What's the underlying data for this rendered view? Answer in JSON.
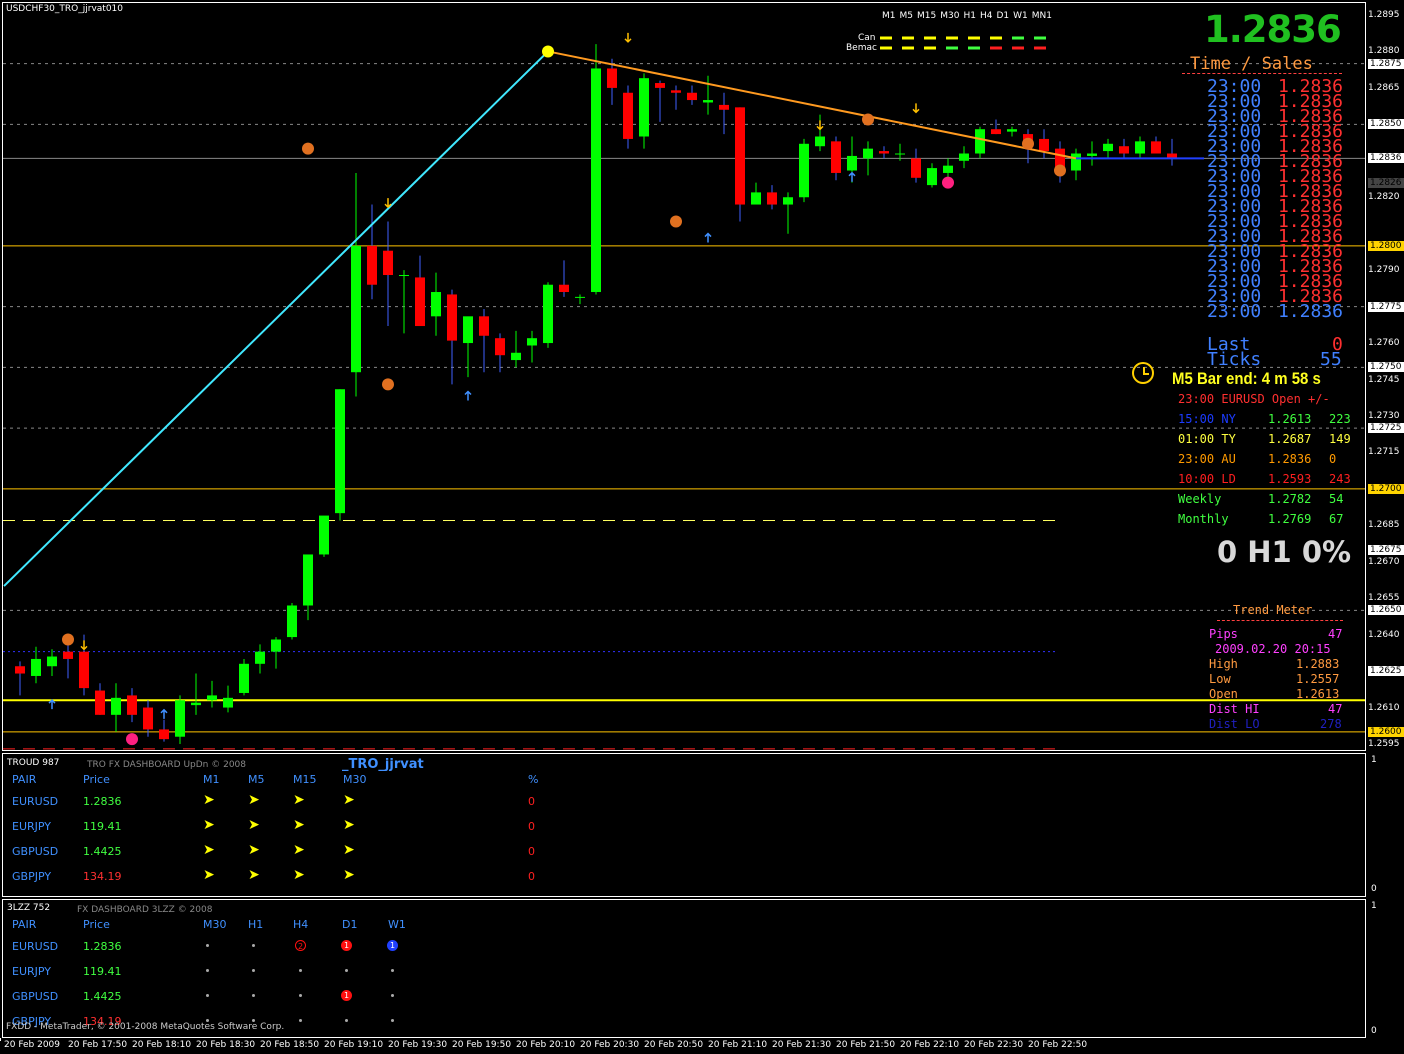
{
  "window": {
    "title": "USDCHF30_TRO_jjrvat010",
    "status_bar": "FXDD - MetaTrader, © 2001-2008 MetaQuotes Software Corp."
  },
  "timeframes": [
    "M1",
    "M5",
    "M15",
    "M30",
    "H1",
    "H4",
    "D1",
    "W1",
    "MN1"
  ],
  "legend": {
    "row1": "Can",
    "row2": "Bemac"
  },
  "big_price": "1.2836",
  "time_sales": {
    "title": "Time / Sales",
    "rows": [
      "23:00",
      "23:00",
      "23:00",
      "23:00",
      "23:00",
      "23:00",
      "23:00",
      "23:00",
      "23:00",
      "23:00",
      "23:00",
      "23:00",
      "23:00",
      "23:00",
      "23:00",
      "23:00"
    ],
    "price": "1.2836",
    "last_label": "Last",
    "last_value": "0",
    "ticks_label": "Ticks",
    "ticks_value": "55"
  },
  "bar_end": "M5 Bar end: 4 m 58 s",
  "sessions": {
    "header": "23:00 EURUSD Open +/-",
    "rows": [
      {
        "time": "15:00",
        "name": "NY",
        "price": "1.2613",
        "pips": "223",
        "color": "#1c3cff"
      },
      {
        "time": "01:00",
        "name": "TY",
        "price": "1.2687",
        "pips": "149",
        "color": "#ffff40"
      },
      {
        "time": "23:00",
        "name": "AU",
        "price": "1.2836",
        "pips": "0",
        "color": "#ff9a00"
      },
      {
        "time": "10:00",
        "name": "LD",
        "price": "1.2593",
        "pips": "243",
        "color": "#ff2020"
      }
    ],
    "weekly": {
      "label": "Weekly",
      "price": "1.2782",
      "pips": "54"
    },
    "monthly": {
      "label": "Monthly",
      "price": "1.2769",
      "pips": "67"
    }
  },
  "h1_pct": "0 H1 0%",
  "trend_meter": {
    "title": "Trend Meter",
    "pips_label": "Pips",
    "pips_value": "47",
    "date": "2009.02.20 20:15",
    "high_label": "High",
    "high_value": "1.2883",
    "low_label": "Low",
    "low_value": "1.2557",
    "open_label": "Open",
    "open_value": "1.2613",
    "dist_hi_label": "Dist HI",
    "dist_hi_value": "47",
    "dist_lo_label": "Dist LO",
    "dist_lo_value": "278"
  },
  "price_labels": [
    "1.2895",
    "1.2880",
    "1.2875",
    "1.2865",
    "1.2850",
    "1.2836",
    "1.2826",
    "1.2820",
    "1.2800",
    "1.2790",
    "1.2775",
    "1.2760",
    "1.2750",
    "1.2745",
    "1.2730",
    "1.2725",
    "1.2715",
    "1.2700",
    "1.2685",
    "1.2675",
    "1.2670",
    "1.2655",
    "1.2650",
    "1.2640",
    "1.2625",
    "1.2610",
    "1.2600",
    "1.2595"
  ],
  "indicator_axis": {
    "top": "1",
    "bottom": "0"
  },
  "dashboard1": {
    "window_label": "TROUD 987",
    "title": "TRO FX DASHBOARD UpDn © 2008",
    "subtitle": "_TRO_jjrvat",
    "headers": {
      "pair": "PAIR",
      "price": "Price",
      "m1": "M1",
      "m5": "M5",
      "m15": "M15",
      "m30": "M30",
      "pct": "%"
    },
    "rows": [
      {
        "pair": "EURUSD",
        "price": "1.2836",
        "price_color": "#40ff40",
        "pct": "0"
      },
      {
        "pair": "EURJPY",
        "price": "119.41",
        "price_color": "#40ff40",
        "pct": "0"
      },
      {
        "pair": "GBPUSD",
        "price": "1.4425",
        "price_color": "#40ff40",
        "pct": "0"
      },
      {
        "pair": "GBPJPY",
        "price": "134.19",
        "price_color": "#ff3030",
        "pct": "0"
      }
    ]
  },
  "dashboard2": {
    "window_label": "3LZZ 752",
    "title": "FX DASHBOARD 3LZZ © 2008",
    "headers": {
      "pair": "PAIR",
      "price": "Price",
      "m30": "M30",
      "h1": "H1",
      "h4": "H4",
      "d1": "D1",
      "w1": "W1"
    },
    "rows": [
      {
        "pair": "EURUSD",
        "price": "1.2836",
        "price_color": "#40ff40",
        "h4": "2",
        "d1": "1",
        "w1": "1"
      },
      {
        "pair": "EURJPY",
        "price": "119.41",
        "price_color": "#40ff40"
      },
      {
        "pair": "GBPUSD",
        "price": "1.4425",
        "price_color": "#40ff40",
        "d1": "1"
      },
      {
        "pair": "GBPJPY",
        "price": "134.19",
        "price_color": "#ff3030"
      }
    ]
  },
  "chart_data": {
    "type": "candlestick",
    "title": "USDCHF30_TRO_jjrvat010",
    "ylim": [
      1.259,
      1.29
    ],
    "x_labels": [
      "20 Feb 2009",
      "20 Feb 17:50",
      "20 Feb 18:10",
      "20 Feb 18:30",
      "20 Feb 18:50",
      "20 Feb 19:10",
      "20 Feb 19:30",
      "20 Feb 19:50",
      "20 Feb 20:10",
      "20 Feb 20:30",
      "20 Feb 20:50",
      "20 Feb 21:10",
      "20 Feb 21:30",
      "20 Feb 21:50",
      "20 Feb 22:10",
      "20 Feb 22:30",
      "20 Feb 22:50"
    ],
    "candles": [
      [
        1.2627,
        1.2629,
        1.2615,
        1.2624
      ],
      [
        1.2623,
        1.2635,
        1.262,
        1.263
      ],
      [
        1.2627,
        1.2634,
        1.2623,
        1.2631
      ],
      [
        1.2633,
        1.2638,
        1.2622,
        1.263
      ],
      [
        1.2633,
        1.264,
        1.2615,
        1.2618
      ],
      [
        1.2617,
        1.262,
        1.2607,
        1.2607
      ],
      [
        1.2607,
        1.262,
        1.26,
        1.2614
      ],
      [
        1.2615,
        1.2618,
        1.2604,
        1.2607
      ],
      [
        1.261,
        1.2613,
        1.2598,
        1.2601
      ],
      [
        1.2601,
        1.2605,
        1.2596,
        1.2597
      ],
      [
        1.2598,
        1.2615,
        1.2595,
        1.2613
      ],
      [
        1.2611,
        1.2624,
        1.2607,
        1.2612
      ],
      [
        1.2613,
        1.2621,
        1.261,
        1.2615
      ],
      [
        1.261,
        1.2619,
        1.2608,
        1.2614
      ],
      [
        1.2616,
        1.263,
        1.2615,
        1.2628
      ],
      [
        1.2628,
        1.2636,
        1.2624,
        1.2633
      ],
      [
        1.2633,
        1.2639,
        1.2626,
        1.2638
      ],
      [
        1.2639,
        1.2653,
        1.2638,
        1.2652
      ],
      [
        1.2652,
        1.2672,
        1.2646,
        1.2673
      ],
      [
        1.2673,
        1.2688,
        1.2672,
        1.2689
      ],
      [
        1.269,
        1.2741,
        1.2687,
        1.2741
      ],
      [
        1.2748,
        1.283,
        1.2738,
        1.28
      ],
      [
        1.28,
        1.2817,
        1.2778,
        1.2784
      ],
      [
        1.2798,
        1.281,
        1.2767,
        1.2788
      ],
      [
        1.2788,
        1.279,
        1.2764,
        1.2788
      ],
      [
        1.2787,
        1.2796,
        1.2767,
        1.2767
      ],
      [
        1.2771,
        1.2789,
        1.2763,
        1.2781
      ],
      [
        1.278,
        1.2782,
        1.2743,
        1.2761
      ],
      [
        1.276,
        1.2764,
        1.2746,
        1.2771
      ],
      [
        1.2771,
        1.2774,
        1.2748,
        1.2763
      ],
      [
        1.2762,
        1.2764,
        1.2748,
        1.2755
      ],
      [
        1.2753,
        1.2765,
        1.275,
        1.2756
      ],
      [
        1.2759,
        1.2765,
        1.2752,
        1.2762
      ],
      [
        1.276,
        1.2785,
        1.2758,
        1.2784
      ],
      [
        1.2784,
        1.2794,
        1.2779,
        1.2781
      ],
      [
        1.2779,
        1.278,
        1.2776,
        1.2779
      ],
      [
        1.2781,
        1.2883,
        1.278,
        1.2873
      ],
      [
        1.2873,
        1.2877,
        1.2858,
        1.2865
      ],
      [
        1.2863,
        1.2866,
        1.284,
        1.2844
      ],
      [
        1.2845,
        1.2871,
        1.284,
        1.2869
      ],
      [
        1.2867,
        1.2868,
        1.2851,
        1.2865
      ],
      [
        1.2864,
        1.2866,
        1.2856,
        1.2863
      ],
      [
        1.2863,
        1.2866,
        1.2858,
        1.286
      ],
      [
        1.2859,
        1.287,
        1.2854,
        1.286
      ],
      [
        1.2858,
        1.2863,
        1.2846,
        1.2856
      ],
      [
        1.2857,
        1.2857,
        1.281,
        1.2817
      ],
      [
        1.2817,
        1.2826,
        1.2817,
        1.2822
      ],
      [
        1.2822,
        1.2825,
        1.2815,
        1.2817
      ],
      [
        1.2817,
        1.2822,
        1.2805,
        1.282
      ],
      [
        1.282,
        1.2844,
        1.2818,
        1.2842
      ],
      [
        1.2841,
        1.2854,
        1.2839,
        1.2845
      ],
      [
        1.2843,
        1.2845,
        1.2827,
        1.283
      ],
      [
        1.2831,
        1.2845,
        1.2826,
        1.2837
      ],
      [
        1.2836,
        1.2843,
        1.2829,
        1.284
      ],
      [
        1.2839,
        1.2841,
        1.2836,
        1.2838
      ],
      [
        1.2838,
        1.2842,
        1.2835,
        1.2838
      ],
      [
        1.2836,
        1.284,
        1.2826,
        1.2828
      ],
      [
        1.2825,
        1.2834,
        1.2824,
        1.2832
      ],
      [
        1.283,
        1.2836,
        1.2828,
        1.2833
      ],
      [
        1.2835,
        1.2841,
        1.2832,
        1.2838
      ],
      [
        1.2838,
        1.2849,
        1.2836,
        1.2848
      ],
      [
        1.2848,
        1.2852,
        1.2846,
        1.2846
      ],
      [
        1.2847,
        1.2849,
        1.2845,
        1.2848
      ],
      [
        1.2846,
        1.2848,
        1.2834,
        1.2843
      ],
      [
        1.2844,
        1.2848,
        1.2836,
        1.2839
      ],
      [
        1.284,
        1.2843,
        1.2826,
        1.2831
      ],
      [
        1.2831,
        1.284,
        1.2827,
        1.2838
      ],
      [
        1.2837,
        1.2843,
        1.2833,
        1.2838
      ],
      [
        1.2839,
        1.2844,
        1.2836,
        1.2842
      ],
      [
        1.2841,
        1.2844,
        1.2836,
        1.2838
      ],
      [
        1.2838,
        1.2845,
        1.2836,
        1.2843
      ],
      [
        1.2843,
        1.2845,
        1.2838,
        1.2838
      ],
      [
        1.2838,
        1.2844,
        1.2833,
        1.2836
      ]
    ],
    "hlines": [
      {
        "y": 1.2875,
        "color": "#888888",
        "style": "dash"
      },
      {
        "y": 1.285,
        "color": "#888888",
        "style": "dash"
      },
      {
        "y": 1.2836,
        "color": "#888888",
        "style": "solid"
      },
      {
        "y": 1.28,
        "color": "#ffc400",
        "style": "solid"
      },
      {
        "y": 1.2775,
        "color": "#888888",
        "style": "dash"
      },
      {
        "y": 1.275,
        "color": "#888888",
        "style": "dash"
      },
      {
        "y": 1.2725,
        "color": "#888888",
        "style": "dash"
      },
      {
        "y": 1.27,
        "color": "#ffc400",
        "style": "solid"
      },
      {
        "y": 1.2687,
        "color": "#ffff60",
        "style": "longdash",
        "short": true
      },
      {
        "y": 1.265,
        "color": "#888888",
        "style": "dash"
      },
      {
        "y": 1.2633,
        "color": "#3030ff",
        "style": "dot",
        "short": true
      },
      {
        "y": 1.2613,
        "color": "#ffff00",
        "style": "solid"
      },
      {
        "y": 1.26,
        "color": "#ffc400",
        "style": "solid"
      },
      {
        "y": 1.2593,
        "color": "#ff2020",
        "style": "longdash",
        "short": true
      }
    ],
    "trend_lines": [
      {
        "x0": -1,
        "y0": 1.266,
        "x1": 33,
        "y1": 1.288,
        "color": "#40e8ff"
      },
      {
        "x0": 33,
        "y0": 1.288,
        "x1": 66,
        "y1": 1.2836,
        "color": "#ff9a20"
      }
    ]
  }
}
